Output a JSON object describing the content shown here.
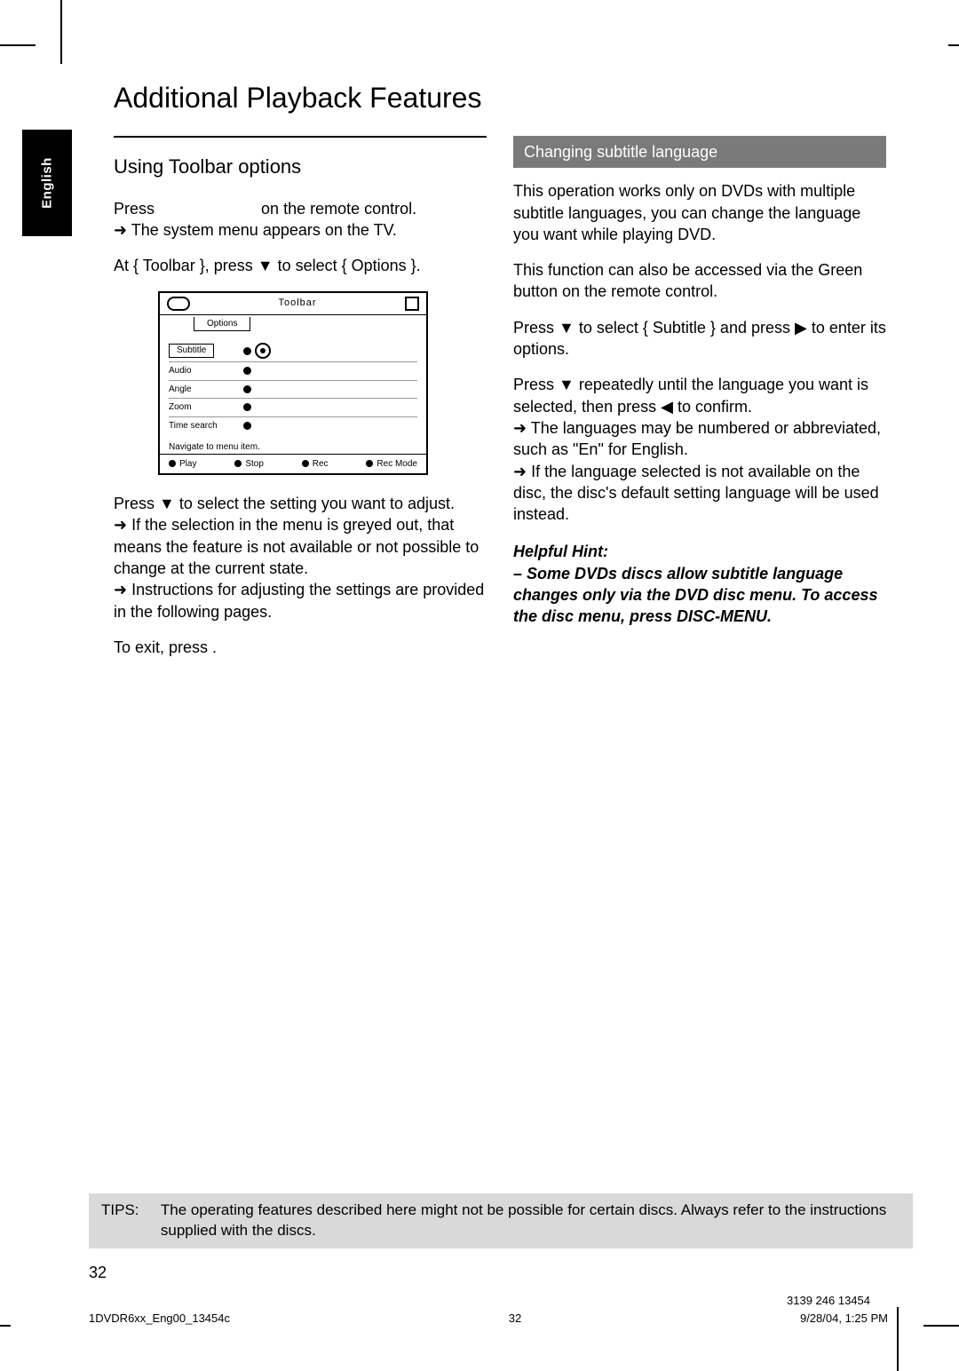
{
  "side_tab": "English",
  "title": "Additional Playback Features",
  "left": {
    "heading": "Using Toolbar options",
    "p1_a": "Press",
    "p1_b": "on the remote control.",
    "p1_arrow": "The system menu appears on the TV.",
    "p2": "At { Toolbar }, press ▼ to select { Options }.",
    "p3_a": "Press ▼ to select the setting you want to adjust.",
    "p3_arrow1": "If the selection in the menu is greyed out, that means the feature is not available or not possible to change at the current state.",
    "p3_arrow2": "Instructions for adjusting the settings are provided in the following pages.",
    "p4": "To exit, press                                    .",
    "diagram": {
      "header_mid": "Toolbar",
      "tab": "Options",
      "rows": [
        "Subtitle",
        "Audio",
        "Angle",
        "Zoom",
        "Time search"
      ],
      "top10": "Navigate to menu item.",
      "foot_left": "Play",
      "foot_mid": "Stop",
      "foot_r1": "Rec",
      "foot_r2": "Rec Mode"
    }
  },
  "right": {
    "bar": "Changing subtitle language",
    "p1": "This operation works only on DVDs with multiple subtitle languages, you can change the language you want while playing DVD.",
    "p2": "This function can also be accessed via the Green button on the remote control.",
    "p3": "Press ▼ to select { Subtitle } and press ▶ to enter its options.",
    "p4a": "Press ▼ repeatedly until the language you want is selected, then press ◀ to confirm.",
    "p4_arrow1": "The languages may be numbered or abbreviated, such as \"En\" for English.",
    "p4_arrow2": "If the language selected is not available on the disc, the disc's default setting language will be used instead.",
    "hint_title": "Helpful Hint:",
    "hint_body": "– Some DVDs discs allow subtitle language changes only via the DVD disc menu. To access the disc menu, press DISC-MENU."
  },
  "tips_label": "TIPS:",
  "tips_body": "The operating features described here might not be possible for certain discs. Always refer to the instructions supplied with the discs.",
  "page_number": "32",
  "footer_left": "1DVDR6xx_Eng00_13454c",
  "footer_mid": "32",
  "footer_right": "9/28/04, 1:25 PM",
  "part_no": "3139 246 13454"
}
